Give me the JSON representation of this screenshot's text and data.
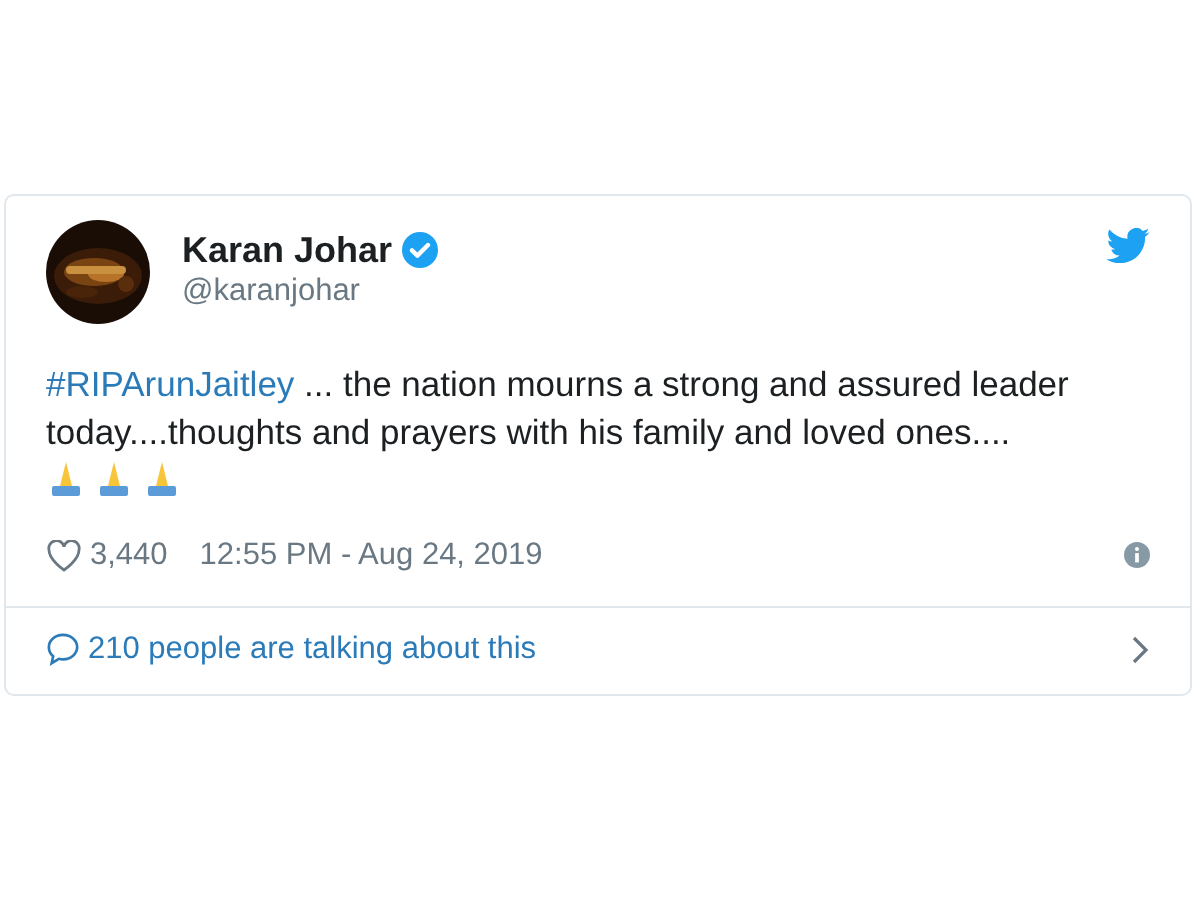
{
  "tweet": {
    "author": {
      "name": "Karan Johar",
      "verified": true,
      "handle": "@karanjohar"
    },
    "hashtag": "#RIPArunJaitley",
    "text": " ... the nation mourns a strong and assured leader today....thoughts and prayers with his family and loved ones....",
    "likes": "3,440",
    "timestamp": "12:55 PM - Aug 24, 2019",
    "conversation": "210 people are talking about this"
  }
}
